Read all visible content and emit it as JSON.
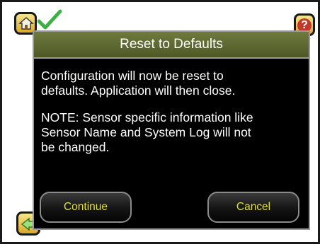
{
  "dialog": {
    "title": "Reset to Defaults",
    "message_lines_1": [
      "Configuration will now be reset to",
      "defaults. Application will then close."
    ],
    "message_lines_2": [
      "NOTE: Sensor specific information like",
      "Sensor Name and System Log will not",
      "be changed."
    ],
    "continue_label": "Continue",
    "cancel_label": "Cancel"
  },
  "icons": {
    "home": "home-icon",
    "check": "checkmark-icon",
    "help": "help-icon",
    "back": "back-arrow-icon"
  },
  "colors": {
    "header_bg": "#5e6a31",
    "dialog_bg": "#000000",
    "button_text": "#e3de2f",
    "help_badge": "#c0392b",
    "check_green": "#3cb043"
  }
}
